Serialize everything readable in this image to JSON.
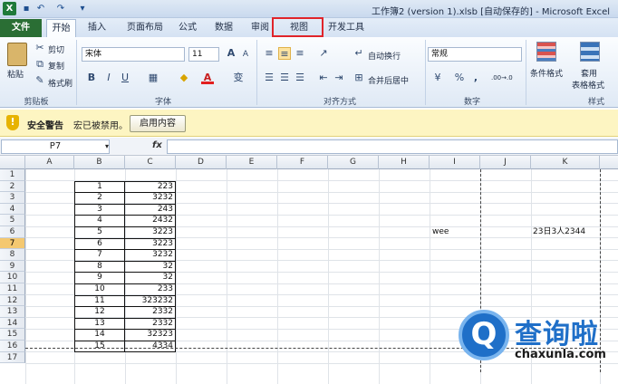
{
  "window": {
    "title": "工作簿2 (version 1).xlsb [自动保存的] - Microsoft Excel",
    "app_icon": "X"
  },
  "quick_access": [
    "save-icon",
    "undo-icon",
    "redo-icon",
    "customize-icon"
  ],
  "tabs": [
    {
      "id": "file",
      "label": "文件"
    },
    {
      "id": "home",
      "label": "开始"
    },
    {
      "id": "insert",
      "label": "插入"
    },
    {
      "id": "layout",
      "label": "页面布局"
    },
    {
      "id": "formula",
      "label": "公式"
    },
    {
      "id": "data",
      "label": "数据"
    },
    {
      "id": "review",
      "label": "审阅"
    },
    {
      "id": "view",
      "label": "视图"
    },
    {
      "id": "developer",
      "label": "开发工具"
    }
  ],
  "ribbon": {
    "clipboard": {
      "paste": "粘贴",
      "cut": "剪切",
      "copy": "复制",
      "format_painter": "格式刷",
      "group": "剪贴板"
    },
    "font": {
      "name": "宋体",
      "size": "11",
      "bold": "B",
      "italic": "I",
      "underline": "U",
      "grow": "A",
      "shrink": "A",
      "color_a": "A",
      "wen": "变",
      "group": "字体"
    },
    "alignment": {
      "wrap": "自动换行",
      "merge": "合并后居中",
      "group": "对齐方式"
    },
    "number": {
      "format": "常规",
      "percent": "%",
      "comma": ",",
      "dec_inc": ".00→.0",
      "dec_dec": ".00→.0",
      "group": "数字"
    },
    "styles": {
      "conditional": "条件格式",
      "table1": "套用",
      "table2": "表格格式",
      "group": "样式"
    }
  },
  "security": {
    "title": "安全警告",
    "message": "宏已被禁用。",
    "button": "启用内容"
  },
  "formula_bar": {
    "namebox": "P7",
    "fx": "fx",
    "value": ""
  },
  "columns": [
    "A",
    "B",
    "C",
    "D",
    "E",
    "F",
    "G",
    "H",
    "I",
    "J",
    "K"
  ],
  "rows": [
    "1",
    "2",
    "3",
    "4",
    "5",
    "6",
    "7",
    "8",
    "9",
    "10",
    "11",
    "12",
    "13",
    "14",
    "15",
    "16",
    "17"
  ],
  "selected_row": "7",
  "table_b": [
    "1",
    "2",
    "3",
    "4",
    "5",
    "6",
    "7",
    "8",
    "9",
    "10",
    "11",
    "12",
    "13",
    "14",
    "15"
  ],
  "table_c": [
    "223",
    "3232",
    "243",
    "2432",
    "3223",
    "3223",
    "3232",
    "32",
    "32",
    "233",
    "323232",
    "2332",
    "2332",
    "32323",
    "4334"
  ],
  "cell_i6": "wee",
  "cell_k6": "23日3人2344",
  "watermark": {
    "text": "查询啦",
    "url": "chaxunla.com",
    "glyph": "Q"
  }
}
